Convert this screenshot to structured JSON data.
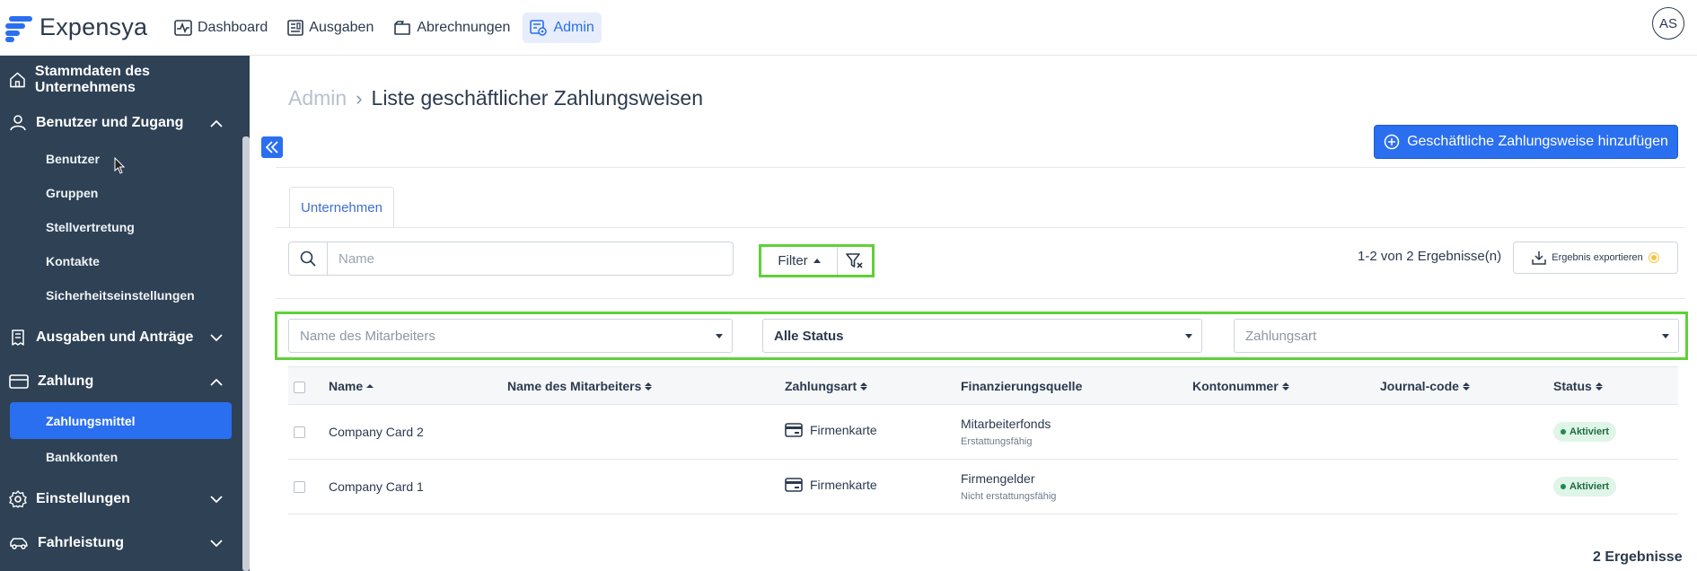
{
  "app": {
    "logo": "Expensya",
    "avatar": "AS"
  },
  "topnav": [
    {
      "label": "Dashboard",
      "icon": "chart-icon"
    },
    {
      "label": "Ausgaben",
      "icon": "receipt-icon"
    },
    {
      "label": "Abrechnungen",
      "icon": "folder-icon"
    },
    {
      "label": "Admin",
      "icon": "admin-icon",
      "active": true
    }
  ],
  "sidebar": {
    "company": "Stammdaten des Unternehmens",
    "users_access": "Benutzer und Zugang",
    "users_sub": [
      "Benutzer",
      "Gruppen",
      "Stellvertretung",
      "Kontakte",
      "Sicherheitseinstellungen"
    ],
    "expenses": "Ausgaben und Anträge",
    "payment": "Zahlung",
    "payment_sub": [
      "Zahlungsmittel",
      "Bankkonten"
    ],
    "settings": "Einstellungen",
    "mileage": "Fahrleistung"
  },
  "breadcrumb": {
    "root": "Admin",
    "current": "Liste geschäftlicher Zahlungsweisen"
  },
  "actions": {
    "add": "Geschäftliche Zahlungsweise hinzufügen",
    "export": "Ergebnis exportieren"
  },
  "tabs": {
    "company": "Unternehmen"
  },
  "search": {
    "placeholder": "Name"
  },
  "filter": {
    "label": "Filter"
  },
  "results": {
    "summary": "1-2 von 2 Ergebnisse(n)",
    "footer": "2 Ergebnisse"
  },
  "filters": {
    "employee": "Name des Mitarbeiters",
    "status": "Alle Status",
    "payment_type": "Zahlungsart"
  },
  "table": {
    "headers": [
      "Name",
      "Name des Mitarbeiters",
      "Zahlungsart",
      "Finanzierungsquelle",
      "Kontonummer",
      "Journal-code",
      "Status"
    ],
    "rows": [
      {
        "name": "Company Card 2",
        "employee": "",
        "type": "Firmenkarte",
        "source": "Mitarbeiterfonds",
        "source_sub": "Erstattungsfähig",
        "account": "",
        "journal": "",
        "status": "Aktiviert"
      },
      {
        "name": "Company Card 1",
        "employee": "",
        "type": "Firmenkarte",
        "source": "Firmengelder",
        "source_sub": "Nicht erstattungsfähig",
        "account": "",
        "journal": "",
        "status": "Aktiviert"
      }
    ]
  },
  "colors": {
    "accent": "#2a6ff0",
    "sidebar": "#2e4155",
    "highlight": "#5fd139",
    "status_bg": "#dff5e8"
  }
}
